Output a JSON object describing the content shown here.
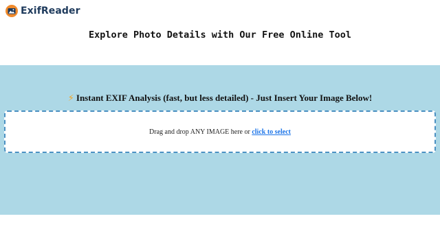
{
  "brand": {
    "name": "ExifReader",
    "icon": "camera-logo-icon",
    "accent": "#f08a2c",
    "text_color": "#1e3a5c"
  },
  "header": {
    "tagline": "Explore Photo Details with Our Free Online Tool"
  },
  "hero": {
    "background": "#add8e6",
    "bolt_icon": "lightning-bolt-icon",
    "heading": "Instant EXIF Analysis (fast, but less detailed) - Just Insert Your Image Below!",
    "dropzone": {
      "text": "Drag and drop ANY IMAGE here or",
      "link": "click to select"
    }
  }
}
